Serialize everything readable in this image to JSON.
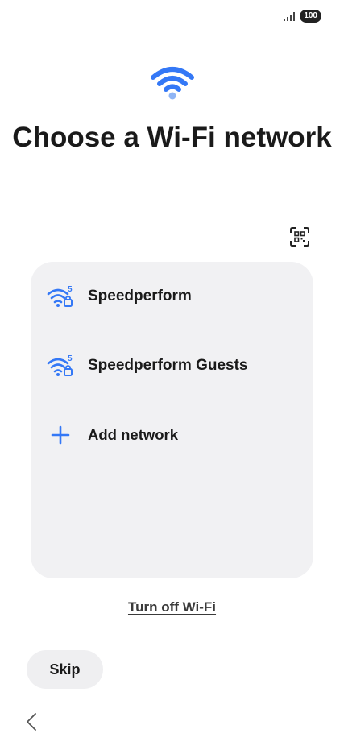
{
  "status_bar": {
    "battery": "100",
    "signal_icon": "signal-bars-icon"
  },
  "header": {
    "icon": "wifi-icon",
    "title": "Choose a Wi-Fi network"
  },
  "qr_scan": {
    "icon": "qr-code-scan-icon"
  },
  "networks": [
    {
      "label": "Speedperform",
      "icon": "wifi-5ghz-locked-icon",
      "band": "5",
      "secured": true
    },
    {
      "label": "Speedperform Guests",
      "icon": "wifi-5ghz-locked-icon",
      "band": "5",
      "secured": true
    }
  ],
  "add_network": {
    "label": "Add network",
    "icon": "plus-icon"
  },
  "turn_off_wifi": {
    "label": "Turn off Wi-Fi"
  },
  "footer": {
    "skip_label": "Skip",
    "back_icon": "chevron-left-icon"
  },
  "colors": {
    "accent": "#3478f6",
    "accent_light": "#8fb5f5",
    "card_background": "#f1f1f3",
    "button_background": "#efeff1",
    "text": "#1a1a1a"
  }
}
